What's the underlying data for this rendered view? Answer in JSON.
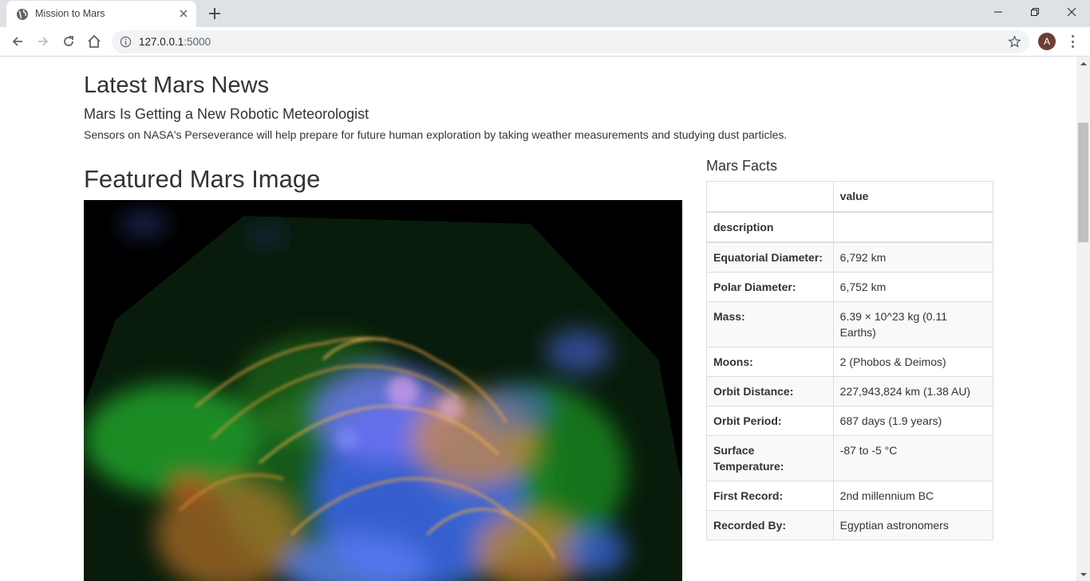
{
  "browser": {
    "tab_title": "Mission to Mars",
    "url_host": "127.0.0.1",
    "url_port": ":5000",
    "avatar_letter": "A"
  },
  "news": {
    "heading": "Latest Mars News",
    "title": "Mars Is Getting a New Robotic Meteorologist",
    "paragraph": "Sensors on NASA's Perseverance will help prepare for future human exploration by taking weather measurements and studying dust particles."
  },
  "featured": {
    "heading": "Featured Mars Image"
  },
  "facts": {
    "heading": "Mars Facts",
    "header_col1": "",
    "header_col2": "value",
    "index_label": "description",
    "rows": [
      {
        "label": "Equatorial Diameter:",
        "value": "6,792 km"
      },
      {
        "label": "Polar Diameter:",
        "value": "6,752 km"
      },
      {
        "label": "Mass:",
        "value": "6.39 × 10^23 kg (0.11 Earths)"
      },
      {
        "label": "Moons:",
        "value": "2 (Phobos & Deimos)"
      },
      {
        "label": "Orbit Distance:",
        "value": "227,943,824 km (1.38 AU)"
      },
      {
        "label": "Orbit Period:",
        "value": "687 days (1.9 years)"
      },
      {
        "label": "Surface Temperature:",
        "value": "-87 to -5 °C"
      },
      {
        "label": "First Record:",
        "value": "2nd millennium BC"
      },
      {
        "label": "Recorded By:",
        "value": "Egyptian astronomers"
      }
    ]
  }
}
